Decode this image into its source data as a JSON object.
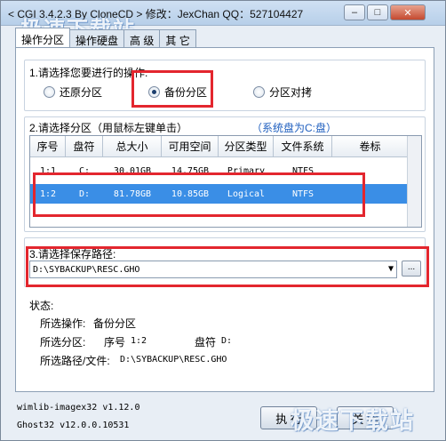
{
  "window": {
    "title": "< CGI 3.4.2.3 By CloneCD > 修改：JexChan  QQ：527104427",
    "minimize": "–",
    "maximize": "□",
    "close": "✕"
  },
  "watermark": "极速下载站",
  "tabs": [
    "操作分区",
    "操作硬盘",
    "高 级",
    "其 它"
  ],
  "operation": {
    "label": "1.请选择您要进行的操作:",
    "options": [
      "还原分区",
      "备份分区",
      "分区对拷"
    ],
    "selected": "备份分区"
  },
  "partition": {
    "label": "2.请选择分区（用鼠标左键单击）",
    "system_note": "（系统盘为C:盘）",
    "columns": [
      "序号",
      "盘符",
      "总大小",
      "可用空间",
      "分区类型",
      "文件系统",
      "卷标"
    ],
    "rows": [
      [
        "1:1",
        "C:",
        "30.01GB",
        "14.75GB",
        "Primary",
        "NTFS",
        ""
      ],
      [
        "1:2",
        "D:",
        "81.78GB",
        "10.85GB",
        "Logical",
        "NTFS",
        ""
      ]
    ],
    "selected_row": 1
  },
  "path": {
    "label": "3.请选择保存路径:",
    "value": "D:\\SYBACKUP\\RESC.GHO",
    "dropdown_arrow": "▼",
    "browse_label": "..."
  },
  "status": {
    "title": "状态:",
    "operation_label": "所选操作:",
    "operation_value": "备份分区",
    "partition_label": "所选分区:",
    "partition_index_label": "序号",
    "partition_index": "1:2",
    "partition_drive_label": "盘符",
    "partition_drive": "D:",
    "path_label": "所选路径/文件:",
    "path_value": "D:\\SYBACKUP\\RESC.GHO"
  },
  "footer": {
    "wimlib": "wimlib-imagex32 v1.12.0",
    "ghost": "Ghost32 v12.0.0.10531"
  },
  "buttons": {
    "execute": "执 行",
    "close": "关 闭"
  },
  "colors": {
    "highlight_box": "#e3262e",
    "selected_row": "#3a8ee6",
    "system_note": "#1f5fbf"
  }
}
